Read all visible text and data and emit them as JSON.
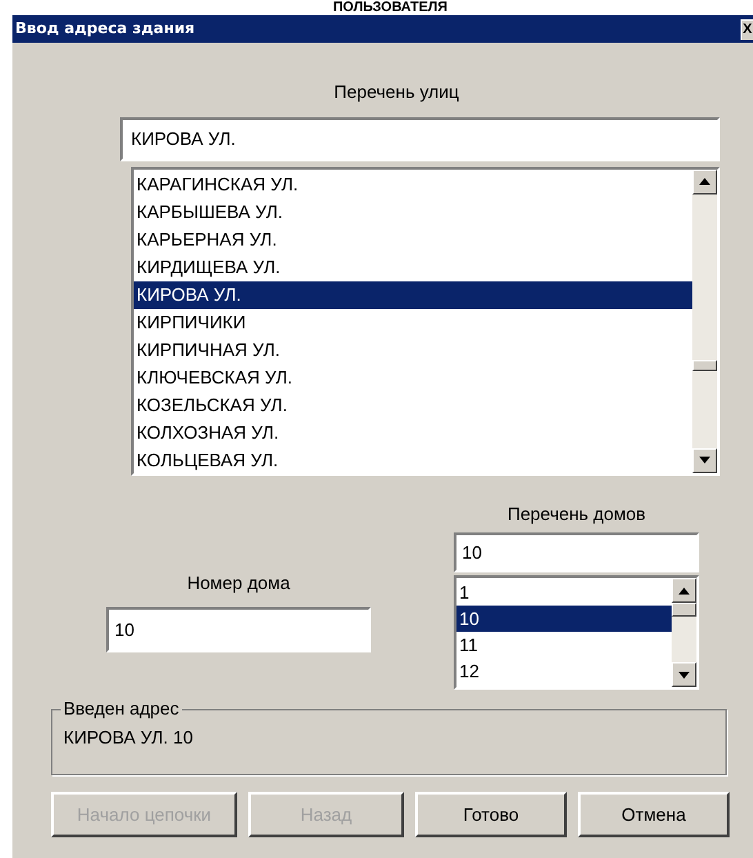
{
  "top_caption": "ПОЛЬЗОВАТЕЛЯ",
  "window": {
    "title": "Ввод адреса здания",
    "close": "X"
  },
  "streets": {
    "label": "Перечень улиц",
    "value": "КИРОВА УЛ.",
    "items": [
      {
        "text": "КАРАГИНСКАЯ УЛ.",
        "selected": false
      },
      {
        "text": "КАРБЫШЕВА УЛ.",
        "selected": false
      },
      {
        "text": "КАРЬЕРНАЯ УЛ.",
        "selected": false
      },
      {
        "text": "КИРДИЩЕВА УЛ.",
        "selected": false
      },
      {
        "text": "КИРОВА УЛ.",
        "selected": true
      },
      {
        "text": "КИРПИЧИКИ",
        "selected": false
      },
      {
        "text": "КИРПИЧНАЯ УЛ.",
        "selected": false
      },
      {
        "text": "КЛЮЧЕВСКАЯ УЛ.",
        "selected": false
      },
      {
        "text": "КОЗЕЛЬСКАЯ УЛ.",
        "selected": false
      },
      {
        "text": "КОЛХОЗНАЯ УЛ.",
        "selected": false
      },
      {
        "text": "КОЛЬЦЕВАЯ УЛ.",
        "selected": false
      }
    ]
  },
  "house_number": {
    "label": "Номер дома",
    "value": "10"
  },
  "houses": {
    "label": "Перечень домов",
    "value": "10",
    "items": [
      {
        "text": "1",
        "selected": false
      },
      {
        "text": "10",
        "selected": true
      },
      {
        "text": "11",
        "selected": false
      },
      {
        "text": "12",
        "selected": false
      }
    ]
  },
  "entered_address": {
    "label": "Введен адрес",
    "value": "КИРОВА УЛ. 10"
  },
  "buttons": [
    {
      "label": "Начало цепочки",
      "disabled": true
    },
    {
      "label": "Назад",
      "disabled": true
    },
    {
      "label": "Готово",
      "disabled": false
    },
    {
      "label": "Отмена",
      "disabled": false
    }
  ]
}
